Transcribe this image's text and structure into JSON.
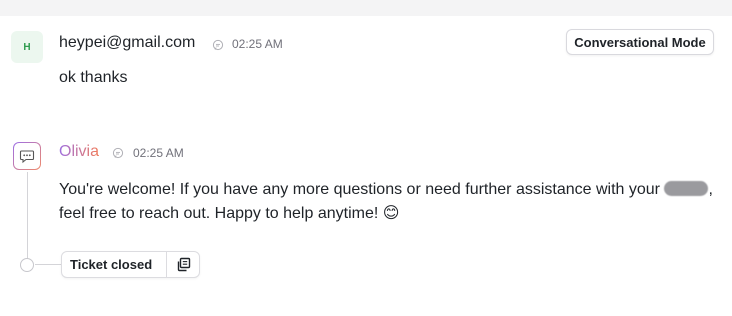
{
  "customer_message": {
    "avatar_initial": "H",
    "sender": "heypei@gmail.com",
    "icon": "chat-bubble-icon",
    "time": "02:25 AM",
    "text": "ok thanks"
  },
  "mode_button": {
    "label": "Conversational Mode"
  },
  "bot_message": {
    "avatar_icon": "chat-bubble-icon",
    "sender": "Olivia",
    "icon": "chat-bubble-icon",
    "time": "02:25 AM",
    "text_part1": "You're welcome! If you have any more questions or need further assistance with your ",
    "text_part2": ", feel free to reach out. Happy to help anytime! ",
    "emoji": "😊"
  },
  "ticket_status": {
    "label": "Ticket closed",
    "icon": "copy-icon"
  },
  "colors": {
    "customer_avatar_bg": "#ecf7ef",
    "customer_avatar_fg": "#2e9b4e",
    "bot_gradient_start": "#9d6ee0",
    "bot_gradient_end": "#f07a5a",
    "muted_text": "#71717a"
  }
}
